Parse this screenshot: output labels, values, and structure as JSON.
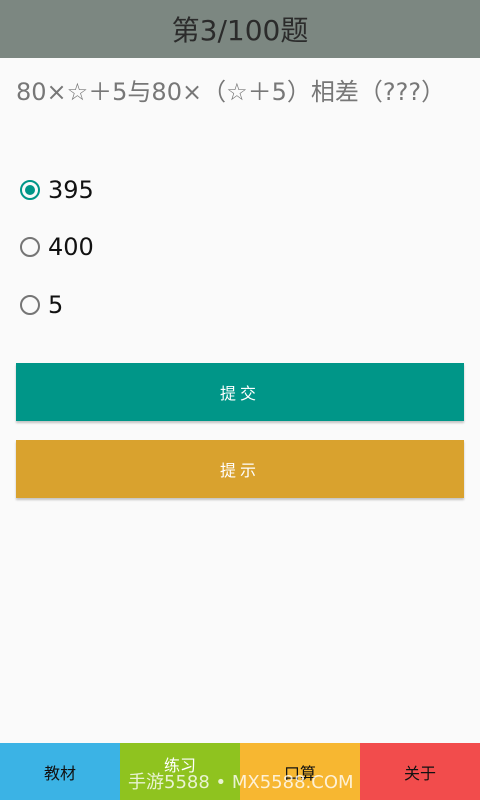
{
  "header": {
    "title": "第3/100题"
  },
  "question": {
    "text": "80×☆＋5与80×（☆＋5）相差（???）"
  },
  "options": [
    {
      "label": "395",
      "checked": true
    },
    {
      "label": "400",
      "checked": false
    },
    {
      "label": "5",
      "checked": false
    }
  ],
  "buttons": {
    "submit": "提交",
    "hint": "提示"
  },
  "tabs": [
    {
      "label": "教材",
      "color": "#3bb3e5"
    },
    {
      "label": "练习",
      "color": "#8fc31f"
    },
    {
      "label": "口算",
      "color": "#f7b731"
    },
    {
      "label": "关于",
      "color": "#f24c4c"
    }
  ],
  "watermark": "手游5588 • MX5588.COM",
  "colors": {
    "header": "#7c8781",
    "accent": "#009688",
    "hint": "#d9a22e"
  }
}
